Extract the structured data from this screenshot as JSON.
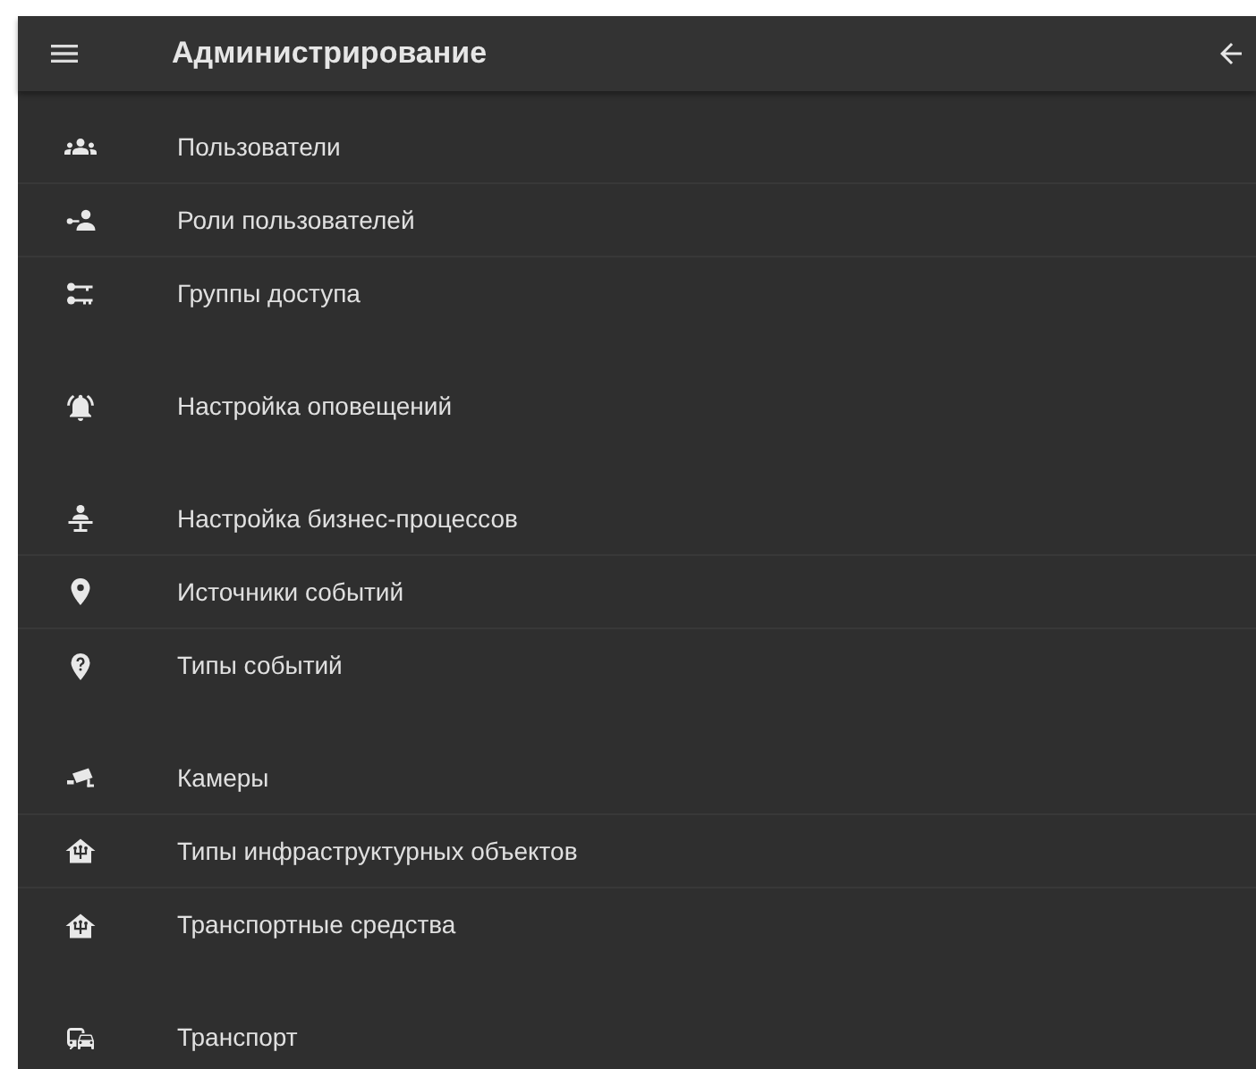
{
  "header": {
    "title": "Администрирование"
  },
  "groups": [
    {
      "items": [
        {
          "label": "Пользователи"
        },
        {
          "label": "Роли пользователей"
        },
        {
          "label": "Группы доступа"
        }
      ]
    },
    {
      "items": [
        {
          "label": "Настройка оповещений"
        }
      ]
    },
    {
      "items": [
        {
          "label": "Настройка бизнес-процессов"
        },
        {
          "label": "Источники событий"
        },
        {
          "label": "Типы событий"
        }
      ]
    },
    {
      "items": [
        {
          "label": "Камеры"
        },
        {
          "label": "Типы инфраструктурных объектов"
        },
        {
          "label": "Транспортные средства"
        }
      ]
    },
    {
      "items": [
        {
          "label": "Транспорт"
        }
      ]
    }
  ]
}
